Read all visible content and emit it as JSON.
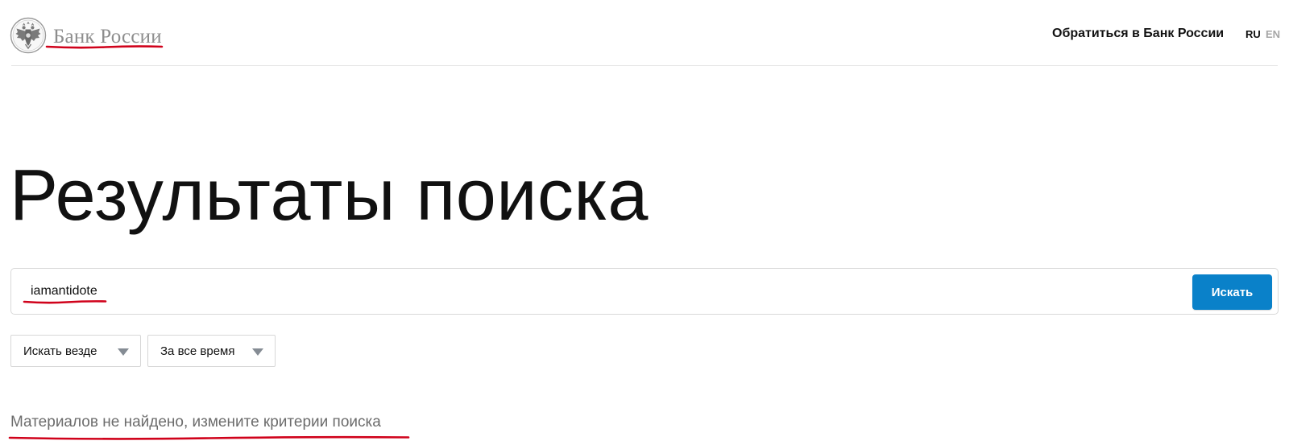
{
  "header": {
    "bank_name": "Банк России",
    "emblem_icon": "double-headed-eagle-icon",
    "contact_link": "Обратиться в Банк России",
    "languages": [
      "RU",
      "EN"
    ],
    "active_language": "RU"
  },
  "page": {
    "title": "Результаты поиска"
  },
  "search": {
    "query": "iamantidote",
    "button_label": "Искать",
    "button_color": "#0a81c9"
  },
  "filters": {
    "scope": "Искать везде",
    "period": "За все время"
  },
  "results": {
    "message": "Материалов не найдено, измените критерии поиска"
  },
  "colors": {
    "annotation": "#d0021b",
    "muted_text": "#8d8d8d"
  }
}
